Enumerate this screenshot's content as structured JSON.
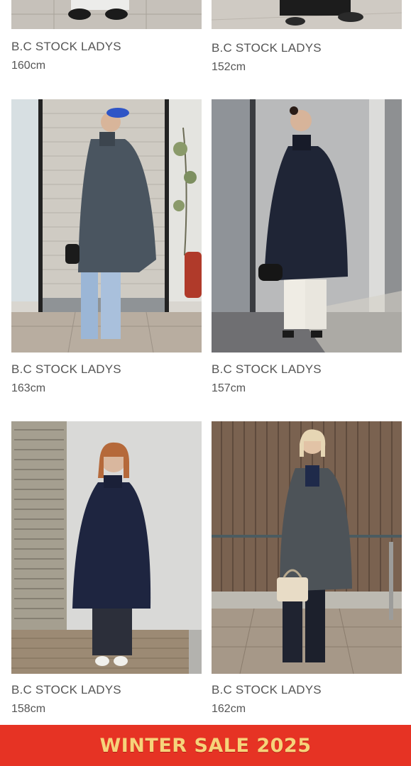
{
  "banner": {
    "text": "WINTER SALE 2025",
    "color": "#f6d37a",
    "background": "#e63324"
  },
  "cards": [
    {
      "store": "B.C STOCK LADYS",
      "height": "160cm",
      "coat_color": "#7a7a7a"
    },
    {
      "store": "B.C STOCK LADYS",
      "height": "152cm",
      "coat_color": "#222222"
    },
    {
      "store": "B.C STOCK LADYS",
      "height": "163cm",
      "coat_color": "#4a5560"
    },
    {
      "store": "B.C STOCK LADYS",
      "height": "157cm",
      "coat_color": "#1f2536"
    },
    {
      "store": "B.C STOCK LADYS",
      "height": "158cm",
      "coat_color": "#1e2540"
    },
    {
      "store": "B.C STOCK LADYS",
      "height": "162cm",
      "coat_color": "#4d5358"
    }
  ]
}
